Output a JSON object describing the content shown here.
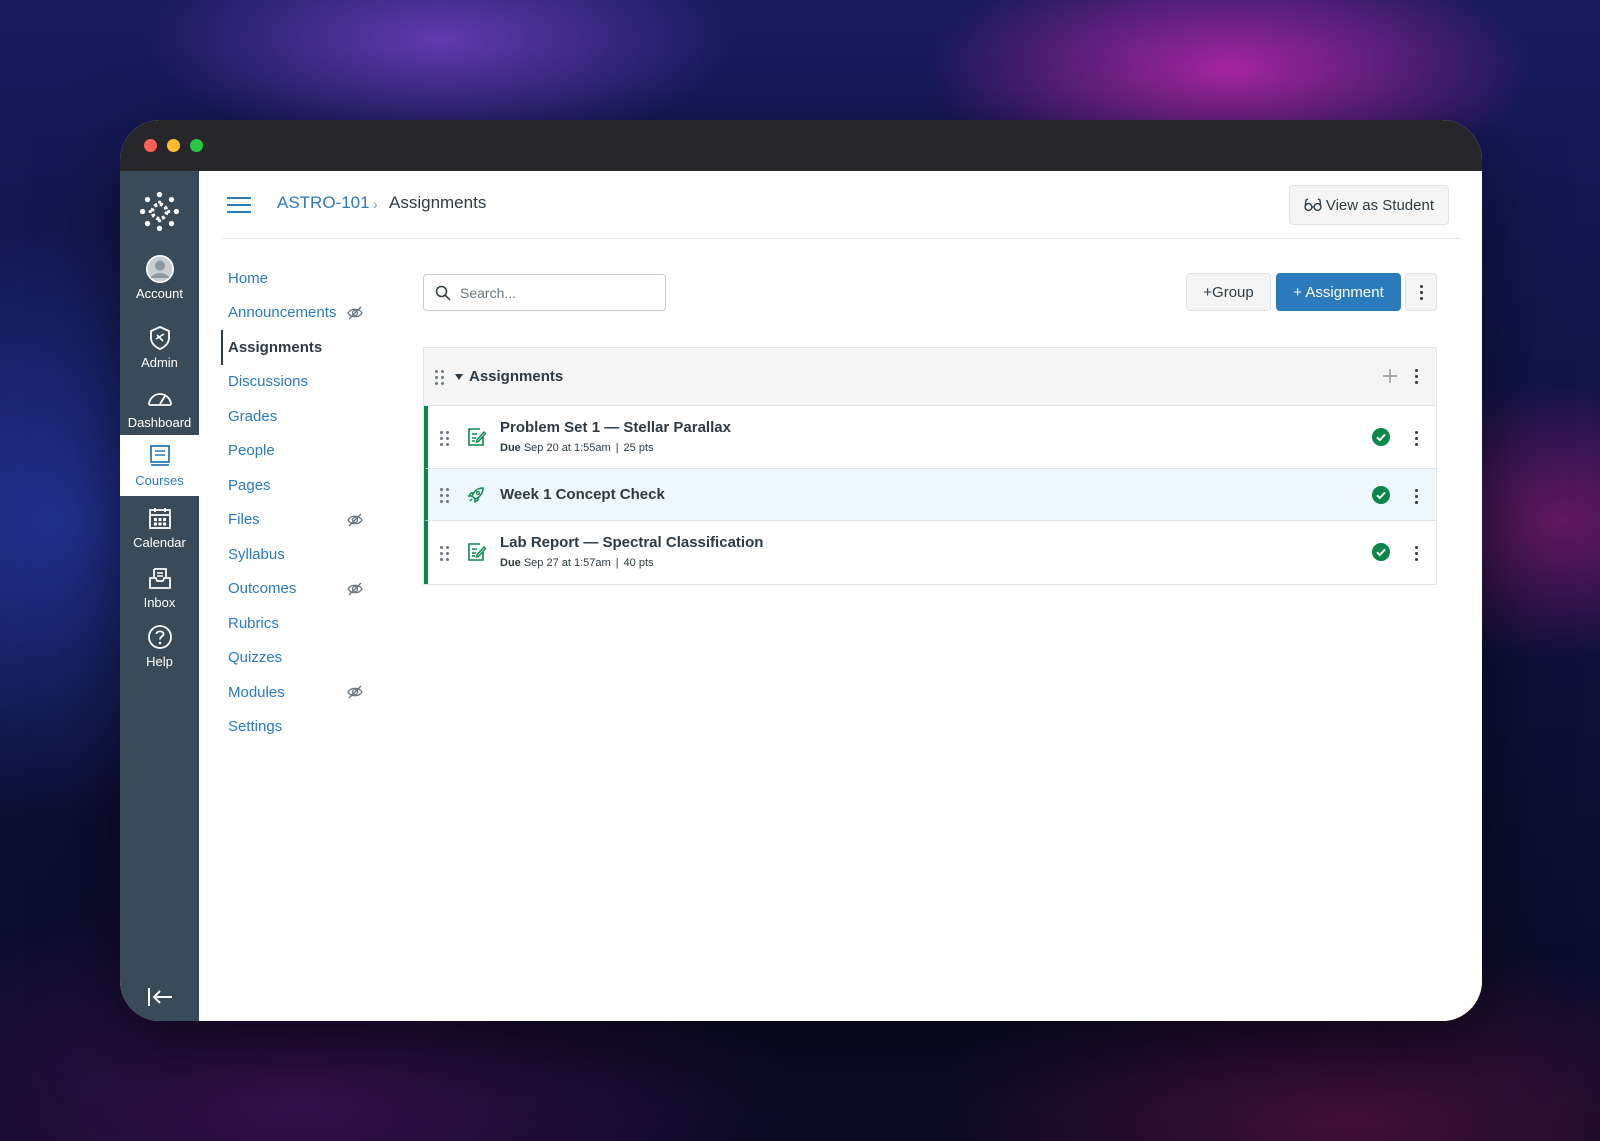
{
  "global_nav": {
    "items": [
      {
        "label": "Account",
        "icon": "account-avatar-icon"
      },
      {
        "label": "Admin",
        "icon": "admin-shield-icon"
      },
      {
        "label": "Dashboard",
        "icon": "dashboard-gauge-icon"
      },
      {
        "label": "Courses",
        "icon": "courses-book-icon",
        "active": true
      },
      {
        "label": "Calendar",
        "icon": "calendar-icon"
      },
      {
        "label": "Inbox",
        "icon": "inbox-icon"
      },
      {
        "label": "Help",
        "icon": "help-icon"
      }
    ],
    "accent": "#394b58"
  },
  "header": {
    "course": "ASTRO-101",
    "separator": "›",
    "page": "Assignments",
    "view_as_student": "View as Student"
  },
  "course_nav": {
    "items": [
      {
        "label": "Home"
      },
      {
        "label": "Announcements",
        "hidden": true
      },
      {
        "label": "Assignments",
        "active": true
      },
      {
        "label": "Discussions"
      },
      {
        "label": "Grades"
      },
      {
        "label": "People"
      },
      {
        "label": "Pages"
      },
      {
        "label": "Files",
        "hidden": true
      },
      {
        "label": "Syllabus"
      },
      {
        "label": "Outcomes",
        "hidden": true
      },
      {
        "label": "Rubrics"
      },
      {
        "label": "Quizzes"
      },
      {
        "label": "Modules",
        "hidden": true
      },
      {
        "label": "Settings"
      }
    ]
  },
  "toolbar": {
    "search_placeholder": "Search...",
    "group_button": "+Group",
    "assignment_button": "+ Assignment"
  },
  "assignment_group": {
    "title": "Assignments",
    "items": [
      {
        "title": "Problem Set 1 — Stellar Parallax",
        "due_label": "Due",
        "due": "Sep 20 at 1:55am",
        "points": "25 pts",
        "icon": "assignment-icon",
        "published": true
      },
      {
        "title": "Week 1 Concept Check",
        "icon": "quiz-rocket-icon",
        "published": true
      },
      {
        "title": "Lab Report — Spectral Classification",
        "due_label": "Due",
        "due": "Sep 27 at 1:57am",
        "points": "40 pts",
        "icon": "assignment-icon",
        "published": true
      }
    ]
  },
  "colors": {
    "link": "#2b7abc",
    "text": "#2d3b45",
    "published_green": "#0b874b",
    "primary_button": "#2b7abc"
  }
}
